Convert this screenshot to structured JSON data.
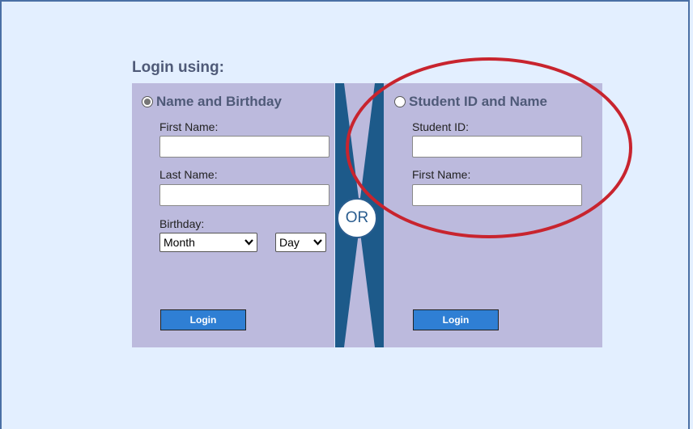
{
  "login": {
    "heading": "Login using:",
    "or_label": "OR"
  },
  "name_birthday": {
    "option_label": "Name and Birthday",
    "selected": true,
    "first_name_label": "First Name:",
    "first_name_value": "",
    "last_name_label": "Last Name:",
    "last_name_value": "",
    "birthday_label": "Birthday:",
    "month_selected": "Month",
    "day_selected": "Day",
    "login_button": "Login"
  },
  "student_id": {
    "option_label": "Student ID and Name",
    "selected": false,
    "student_id_label": "Student ID:",
    "student_id_value": "",
    "first_name_label": "First Name:",
    "first_name_value": "",
    "login_button": "Login"
  },
  "colors": {
    "background": "#e3efff",
    "panel": "#bcbadd",
    "divider": "#1d5a8a",
    "button": "#2f7fd4",
    "annotation": "#c8242e"
  }
}
